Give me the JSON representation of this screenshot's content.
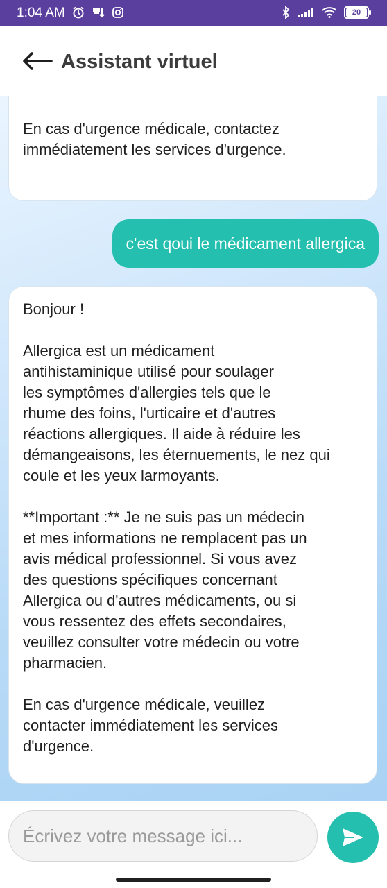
{
  "status_bar": {
    "time": "1:04 AM",
    "battery": "20",
    "background_color": "#5b3f9e"
  },
  "app_bar": {
    "title": "Assistant virtuel",
    "back_icon": "arrow-left-icon"
  },
  "messages": [
    {
      "sender": "bot",
      "text": "pharmacien.\n\nEn cas d'urgence médicale, contactez\nimmédiatement les services d'urgence."
    },
    {
      "sender": "user",
      "text": "c'est qoui le médicament allergica"
    },
    {
      "sender": "bot",
      "text": "Bonjour !\n\nAllergica est un médicament\nantihistaminique utilisé pour soulager\nles symptômes d'allergies tels que le\nrhume des foins, l'urticaire et d'autres\nréactions allergiques. Il aide à réduire les\ndémangeaisons, les éternuements, le nez qui\ncoule et les yeux larmoyants.\n\n**Important :** Je ne suis pas un médecin\net mes informations ne remplacent pas un\navis médical professionnel. Si vous avez\ndes questions spécifiques concernant\nAllergica ou d'autres médicaments, ou si\nvous ressentez des effets secondaires,\nveuillez consulter votre médecin ou votre\npharmacien.\n\nEn cas d'urgence médicale, veuillez\ncontacter immédiatement les services\nd'urgence."
    }
  ],
  "composer": {
    "placeholder": "Écrivez votre message ici...",
    "value": "",
    "send_icon": "send-icon"
  },
  "colors": {
    "accent": "#24bfae",
    "header_bar": "#5b3f9e",
    "title_text": "#3c3c3c"
  }
}
